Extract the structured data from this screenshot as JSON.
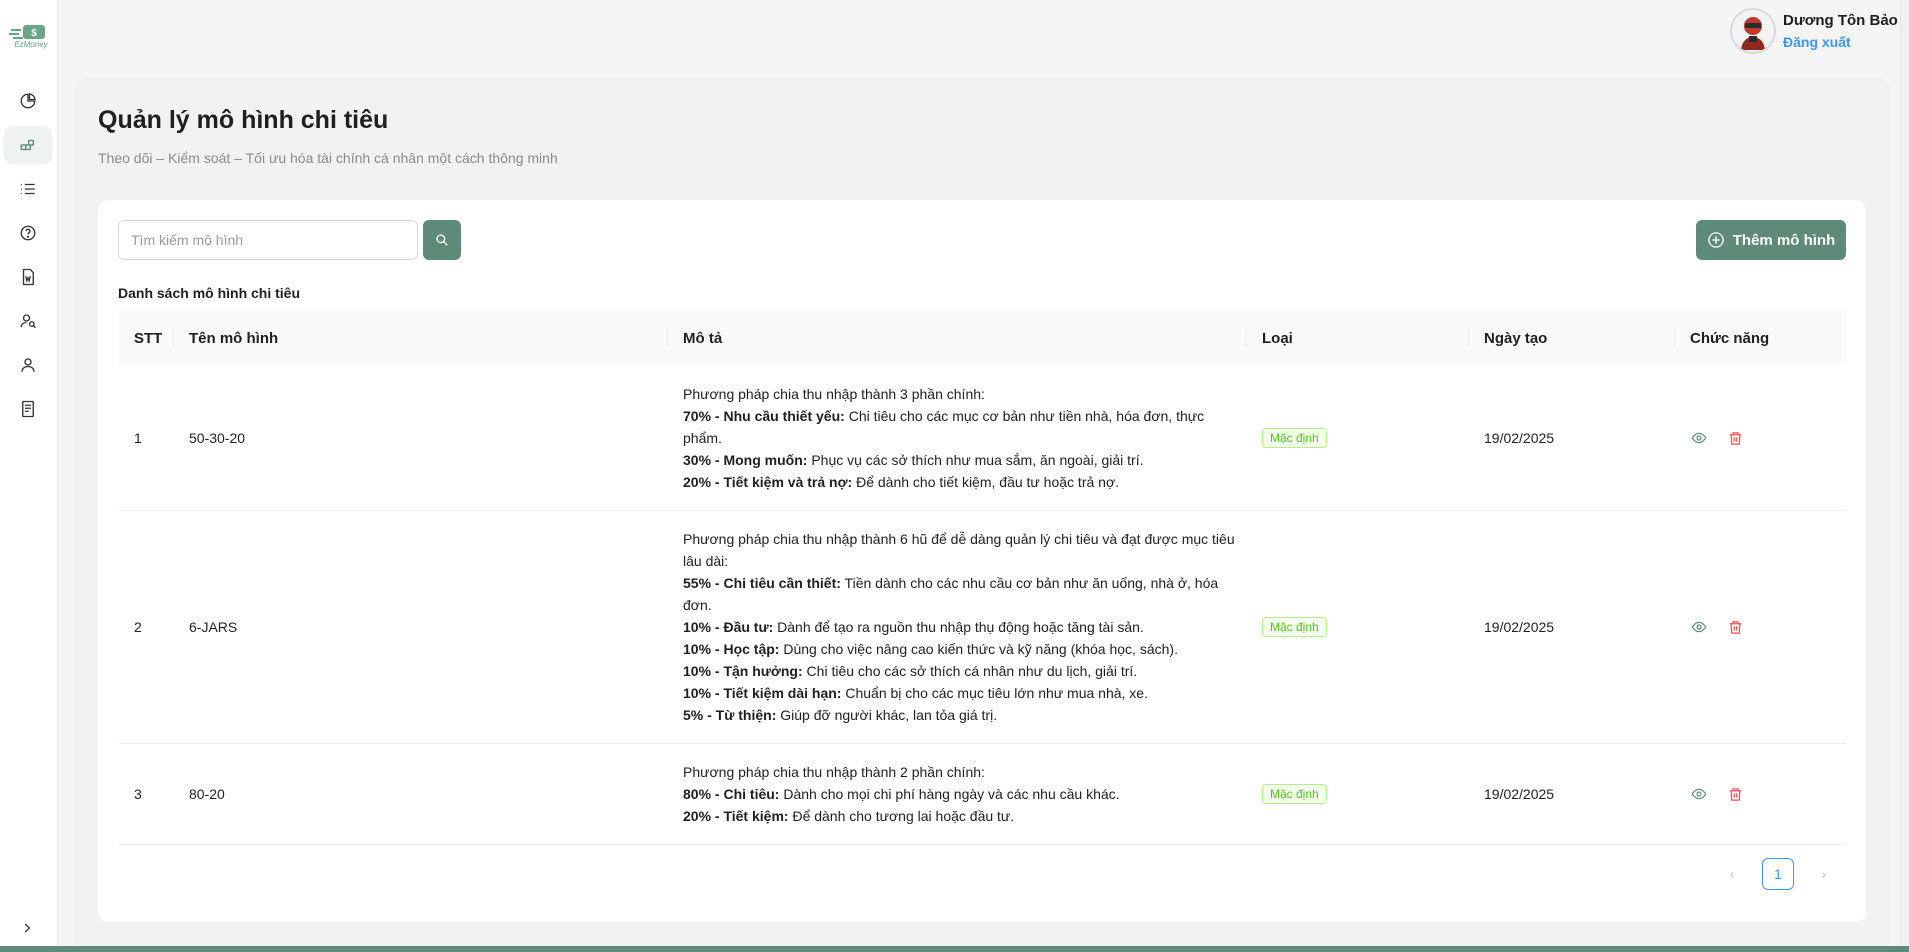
{
  "brand": {
    "logo_text": "EzMoney",
    "accent": "#5f8a78"
  },
  "sidebar": {
    "items": [
      {
        "icon": "pie-chart-icon"
      },
      {
        "icon": "blocks-icon",
        "active": true
      },
      {
        "icon": "list-icon"
      },
      {
        "icon": "help-icon"
      },
      {
        "icon": "document-icon"
      },
      {
        "icon": "user-search-icon"
      },
      {
        "icon": "user-icon"
      },
      {
        "icon": "receipt-icon"
      }
    ],
    "collapse_icon": "chevron-right-icon"
  },
  "user": {
    "name": "Dương Tôn Bảo",
    "logout_label": "Đăng xuất"
  },
  "page": {
    "title": "Quản lý mô hình chi tiêu",
    "subtitle": "Theo dõi – Kiểm soát – Tối ưu hóa tài chính cá nhân một cách thông minh"
  },
  "search": {
    "placeholder": "Tìm kiếm mô hình"
  },
  "add_button": {
    "label": "Thêm mô hình"
  },
  "list": {
    "title": "Danh sách mô hình chi tiêu"
  },
  "table": {
    "headers": {
      "stt": "STT",
      "name": "Tên mô hình",
      "desc": "Mô tả",
      "type": "Loại",
      "date": "Ngày tạo",
      "actions": "Chức năng"
    },
    "rows": [
      {
        "stt": "1",
        "name": "50-30-20",
        "desc_intro": "Phương pháp chia thu nhập thành 3 phần chính:",
        "desc_lines": [
          {
            "b": "70% - Nhu cầu thiết yếu:",
            "t": " Chi tiêu cho các mục cơ bản như tiền nhà, hóa đơn, thực phẩm."
          },
          {
            "b": "30% - Mong muốn:",
            "t": " Phục vụ các sở thích như mua sắm, ăn ngoài, giải trí."
          },
          {
            "b": "20% - Tiết kiệm và trả nợ:",
            "t": " Để dành cho tiết kiệm, đầu tư hoặc trả nợ."
          }
        ],
        "type": "Mặc định",
        "date": "19/02/2025"
      },
      {
        "stt": "2",
        "name": "6-JARS",
        "desc_intro": "Phương pháp chia thu nhập thành 6 hũ để dễ dàng quản lý chi tiêu và đạt được mục tiêu lâu dài:",
        "desc_lines": [
          {
            "b": "55% - Chi tiêu cần thiết:",
            "t": " Tiền dành cho các nhu cầu cơ bản như ăn uống, nhà ở, hóa đơn."
          },
          {
            "b": "10% - Đầu tư:",
            "t": " Dành để tạo ra nguồn thu nhập thụ động hoặc tăng tài sản."
          },
          {
            "b": "10% - Học tập:",
            "t": " Dùng cho việc nâng cao kiến thức và kỹ năng (khóa học, sách)."
          },
          {
            "b": "10% - Tận hưởng:",
            "t": " Chi tiêu cho các sở thích cá nhân như du lịch, giải trí."
          },
          {
            "b": "10% - Tiết kiệm dài hạn:",
            "t": " Chuẩn bị cho các mục tiêu lớn như mua nhà, xe."
          },
          {
            "b": "5% - Từ thiện:",
            "t": " Giúp đỡ người khác, lan tỏa giá trị."
          }
        ],
        "type": "Mặc định",
        "date": "19/02/2025"
      },
      {
        "stt": "3",
        "name": "80-20",
        "desc_intro": "Phương pháp chia thu nhập thành 2 phần chính:",
        "desc_lines": [
          {
            "b": "80% - Chi tiêu:",
            "t": " Dành cho mọi chi phí hàng ngày và các nhu cầu khác."
          },
          {
            "b": "20% - Tiết kiệm:",
            "t": " Để dành cho tương lai hoặc đầu tư."
          }
        ],
        "type": "Mặc định",
        "date": "19/02/2025"
      }
    ]
  },
  "pagination": {
    "current": "1",
    "prev": "‹",
    "next": "›"
  }
}
